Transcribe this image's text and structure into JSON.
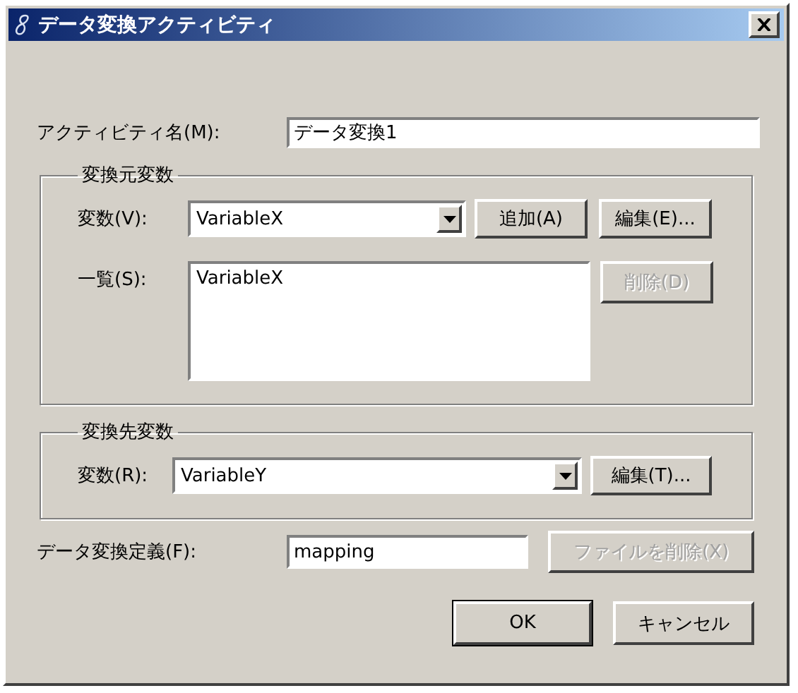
{
  "window": {
    "title": "データ変換アクティビティ"
  },
  "activity_name": {
    "label": "アクティビティ名(M):",
    "value": "データ変換1"
  },
  "source_group": {
    "title": "変換元変数",
    "variable": {
      "label": "変数(V):",
      "value": "VariableX"
    },
    "buttons": [
      {
        "label": "追加(A)",
        "disabled": false
      },
      {
        "label": "編集(E)...",
        "disabled": false
      }
    ],
    "list": {
      "label": "一覧(S):",
      "items": [
        {
          "text": "VariableX",
          "selected": false
        }
      ]
    },
    "delete_button": {
      "label": "削除(D)",
      "disabled": true
    }
  },
  "target_group": {
    "title": "変換先変数",
    "variable": {
      "label": "変数(R):",
      "value": "VariableY"
    },
    "edit_button": {
      "label": "編集(T)...",
      "disabled": false
    }
  },
  "definition": {
    "label": "データ変換定義(F):",
    "value": "mapping"
  },
  "delete_file_button": {
    "label": "ファイルを削除(X)",
    "disabled": true
  },
  "buttons": [
    {
      "label": "OK",
      "default": true,
      "disabled": false
    },
    {
      "label": "キャンセル",
      "default": false,
      "disabled": false
    }
  ]
}
